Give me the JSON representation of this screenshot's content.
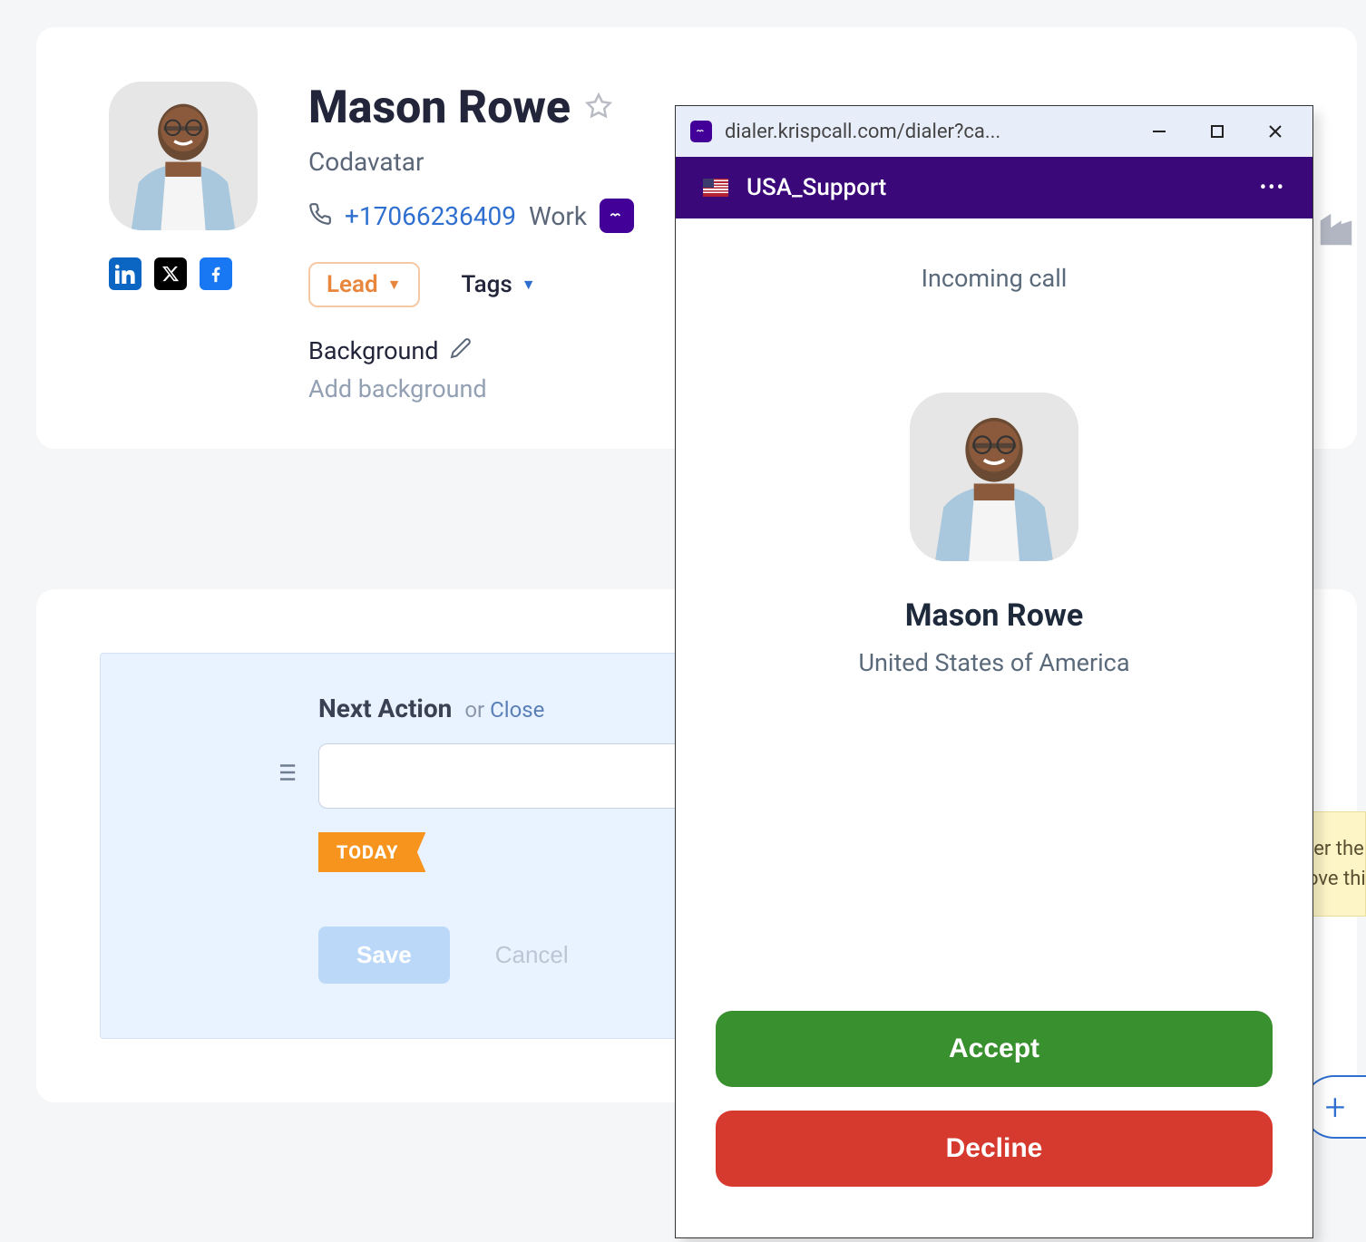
{
  "contact": {
    "name": "Mason Rowe",
    "company": "Codavatar",
    "phone": "+17066236409",
    "phone_label": "Work",
    "lead_label": "Lead",
    "tags_label": "Tags",
    "background_label": "Background",
    "background_placeholder": "Add background"
  },
  "action": {
    "title": "Next Action",
    "or_text": "or ",
    "close_link": "Close",
    "today_label": "TODAY",
    "save_label": "Save",
    "cancel_label": "Cancel"
  },
  "note": {
    "line1": "ter the c",
    "line2": "ove this"
  },
  "dialer": {
    "url": "dialer.krispcall.com/dialer?ca...",
    "header_title": "USA_Support",
    "incoming_label": "Incoming call",
    "caller_name": "Mason Rowe",
    "caller_location": "United States of America",
    "accept_label": "Accept",
    "decline_label": "Decline"
  },
  "colors": {
    "accent_blue": "#2f6fd0",
    "orange": "#f7941e",
    "purple": "#3a0878"
  }
}
